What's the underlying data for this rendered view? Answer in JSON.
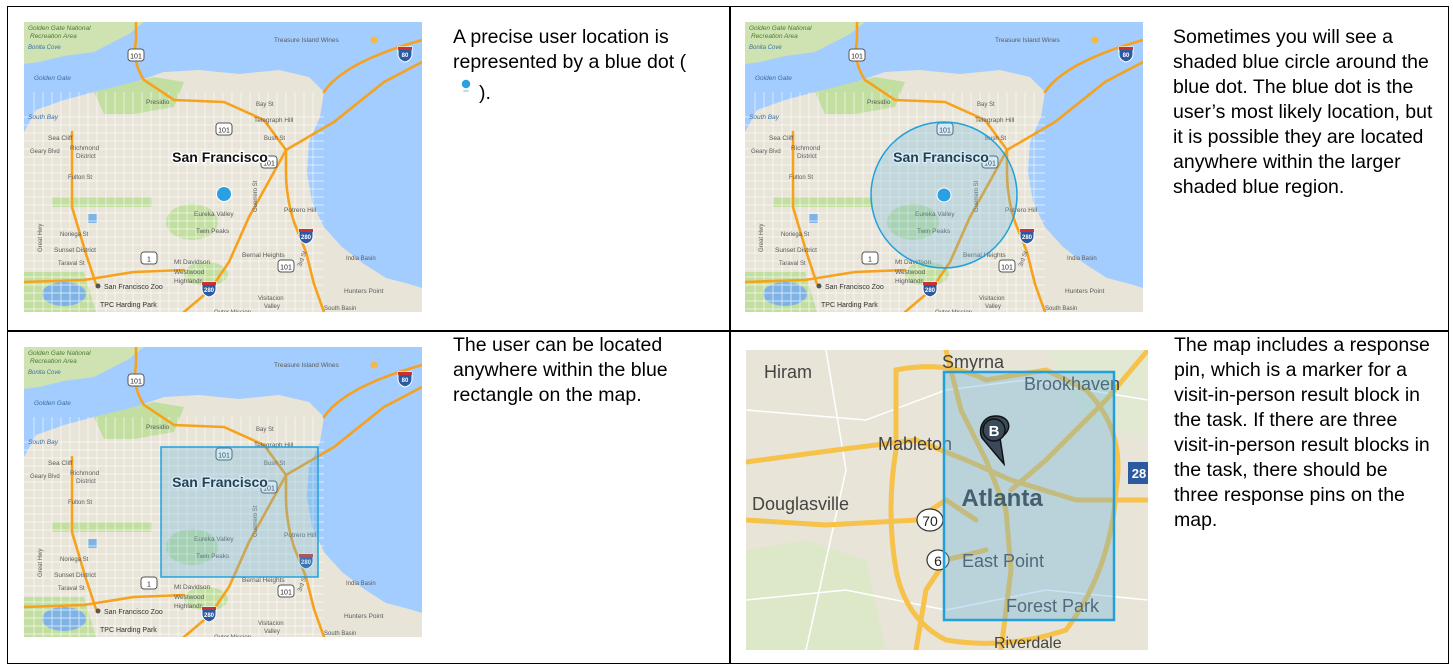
{
  "panels": [
    {
      "text_parts": [
        "A precise user location is represented by a blue dot (",
        ")."
      ],
      "map": {
        "city": "San Francisco",
        "overlay": "dot"
      }
    },
    {
      "text": "Sometimes you will see a shaded blue circle around the blue dot. The blue dot is the user’s most likely location, but it is possible they are located anywhere within the larger shaded blue region.",
      "map": {
        "city": "San Francisco",
        "overlay": "circle"
      }
    },
    {
      "text": "The user can be located anywhere within the blue rectangle on the map.",
      "map": {
        "city": "San Francisco",
        "overlay": "rectangle"
      }
    },
    {
      "text": "The map includes a response pin, which is a marker for a visit-in-person result block in the task.  If there are three visit-in-person result blocks in the task, there should be three response pins on the map.",
      "map": {
        "city": "Atlanta",
        "overlay": "rectangle-with-pin"
      }
    }
  ],
  "sf_labels": {
    "golden_gate_nra": "Golden Gate National",
    "recreation_area": "Recreation Area",
    "bonita_cove": "Bonita Cove",
    "golden_gate": "Golden Gate",
    "treasure_island": "Treasure Island Wines",
    "presidio": "Presidio",
    "south_bay": "South Bay",
    "sea_cliff": "Sea Cliff",
    "geary": "Geary Blvd",
    "richmond": "Richmond",
    "district": "District",
    "fulton": "Fulton St",
    "bay_st": "Bay St",
    "telegraph": "Telegraph Hill",
    "bush_st": "Bush St",
    "eureka": "Eureka Valley",
    "twin_peaks": "Twin Peaks",
    "potrero": "Potrero Hill",
    "noriega": "Noriega St",
    "sunset": "Sunset District",
    "taraval": "Taraval St",
    "great_hwy": "Great Hwy",
    "mt_davidson": "Mt Davidson",
    "westwood": "Westwood",
    "highlands": "Highlands",
    "bernal": "Bernal Heights",
    "india_basin": "India Basin",
    "sf_zoo": "San Francisco Zoo",
    "hunters_point": "Hunters Point",
    "tpc": "TPC Harding Park",
    "visitacion": "Visitacion",
    "valley": "Valley",
    "south_basin": "South Basin",
    "outer_mission": "Outer Mission",
    "third_st": "3rd St",
    "guerrero": "Guerrero St",
    "shield_101": "101",
    "shield_280": "280",
    "shield_80": "80",
    "shield_1": "1"
  },
  "atl_labels": {
    "hiram": "Hiram",
    "smyrna": "Smyrna",
    "brookhaven": "Brookhaven",
    "mableton": "Mableton",
    "douglasville": "Douglasville",
    "atlanta": "Atlanta",
    "east_point": "East Point",
    "forest_park": "Forest Park",
    "riverdale": "Riverdale",
    "shield_70": "70",
    "shield_6": "6",
    "shield_28": "28",
    "pin_letter": "B"
  },
  "colors": {
    "water": "#a3ccff",
    "land": "#e8e4d8",
    "park": "#c2dea0",
    "highway": "#f6a21c",
    "location_blue": "#2a9fe2",
    "shade_fill": "#64b2df"
  }
}
